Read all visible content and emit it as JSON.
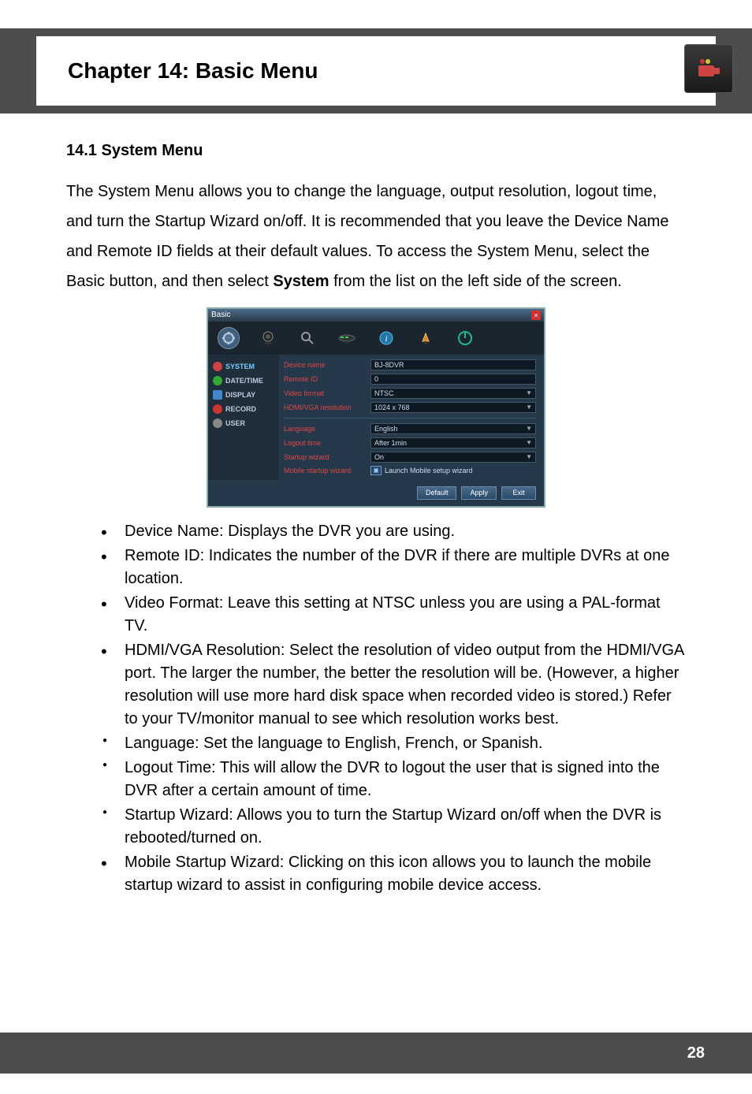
{
  "header": {
    "chapter_title": "Chapter 14: Basic Menu",
    "icon_name": "camera-icon"
  },
  "section": {
    "heading": "14.1 System Menu",
    "intro_parts": {
      "p1": "The System Menu allows you to change the language, output resolution, logout time, and turn the Startup Wizard on/off. It is recommended that you leave the Device Name and Remote ID fields at their default values.  To access the System Menu, select the Basic button, and then select ",
      "p1_bold": "System",
      "p2": " from the list on the left side of the screen."
    }
  },
  "dvr": {
    "title": "Basic",
    "toolbar_icons": [
      "tools-icon",
      "webcam-icon",
      "search-icon",
      "network-icon",
      "info-icon",
      "alarm-icon",
      "power-icon"
    ],
    "sidebar": [
      {
        "icon": "gear-icon",
        "label": "SYSTEM",
        "selected": true,
        "color": "#c44"
      },
      {
        "icon": "clock-icon",
        "label": "DATE/TIME",
        "selected": false,
        "color": "#3a3"
      },
      {
        "icon": "monitor-icon",
        "label": "DISPLAY",
        "selected": false,
        "color": "#48c"
      },
      {
        "icon": "disc-icon",
        "label": "RECORD",
        "selected": false,
        "color": "#c33"
      },
      {
        "icon": "user-icon",
        "label": "USER",
        "selected": false,
        "color": "#888"
      }
    ],
    "fields_top": [
      {
        "label": "Device name",
        "value": "BJ-8DVR",
        "dropdown": false
      },
      {
        "label": "Remote ID",
        "value": "0",
        "dropdown": false
      },
      {
        "label": "Video format",
        "value": "NTSC",
        "dropdown": true
      },
      {
        "label": "HDMI/VGA resolution",
        "value": "1024 x 768",
        "dropdown": true
      }
    ],
    "fields_bottom": [
      {
        "label": "Language",
        "value": "English",
        "dropdown": true
      },
      {
        "label": "Logout time",
        "value": "After 1min",
        "dropdown": true
      },
      {
        "label": "Startup wizard",
        "value": "On",
        "dropdown": true
      }
    ],
    "mobile_row": {
      "label": "Mobile startup wizard",
      "button_text": "Launch Mobile setup wizard"
    },
    "footer_buttons": [
      "Default",
      "Apply",
      "Exit"
    ]
  },
  "bullets": [
    {
      "style": "big",
      "lead": "Device Name:",
      "text": " Displays the DVR you are using."
    },
    {
      "style": "big",
      "lead": "Remote ID:",
      "text": " Indicates the number of the DVR if there are multiple DVRs at one location."
    },
    {
      "style": "big",
      "lead": "Video Format:",
      "text": " Leave this setting at NTSC unless you are using a PAL-format TV."
    },
    {
      "style": "big",
      "lead": "HDMI/VGA Resolution:",
      "text": " Select the resolution of video output from the HDMI/VGA port. The larger the number, the better the resolution will be. (However, a higher resolution will use more hard disk space when recorded video is stored.) Refer to your TV/monitor manual to see which resolution works best."
    },
    {
      "style": "small",
      "lead": "Language",
      "text": ": Set the language to English, French, or Spanish."
    },
    {
      "style": "small",
      "lead": "Logout Time:",
      "text": " This will allow the DVR to logout the user that is signed into the DVR after a certain amount of time."
    },
    {
      "style": "small",
      "lead": "Startup Wizard",
      "text": ": Allows you to turn the Startup Wizard on/off when the DVR is rebooted/turned on."
    },
    {
      "style": "big",
      "lead": "Mobile Startup Wizard:",
      "text": " Clicking on this icon allows you to launch the mobile startup wizard to assist in configuring mobile device access."
    }
  ],
  "footer": {
    "page_number": "28"
  }
}
